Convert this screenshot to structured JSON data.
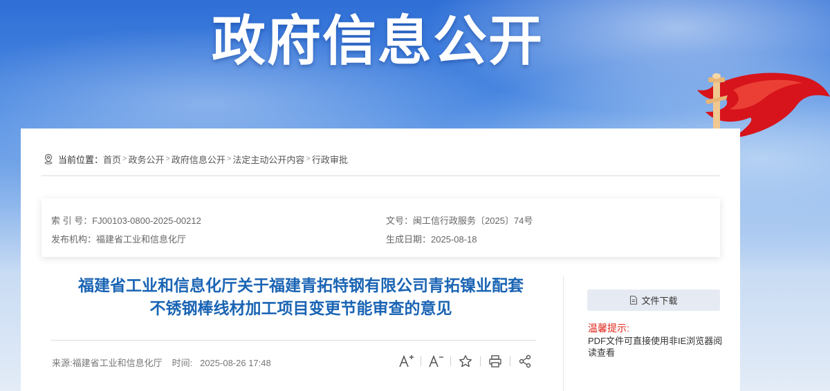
{
  "banner": {
    "title": "政府信息公开"
  },
  "breadcrumb": {
    "label": "当前位置：",
    "items": [
      "首页",
      "政务公开",
      "政府信息公开",
      "法定主动公开内容",
      "行政审批"
    ],
    "separator": ">"
  },
  "meta": {
    "index_label": "索 引 号：",
    "index_value": "FJ00103-0800-2025-00212",
    "doc_no_label": "文号：",
    "doc_no_value": "闽工信行政服务〔2025〕74号",
    "publisher_label": "发布机构：",
    "publisher_value": "福建省工业和信息化厅",
    "date_label": "生成日期：",
    "date_value": "2025-08-18"
  },
  "article": {
    "title_line1": "福建省工业和信息化厅关于福建青拓特钢有限公司青拓镍业配套",
    "title_line2": "不锈钢棒线材加工项目变更节能审查的意见",
    "source": "来源:福建省工业和信息化厅",
    "time_label": "时间:",
    "time_value": "2025-08-26 17:48"
  },
  "tools": [
    "font-larger-icon",
    "font-smaller-icon",
    "favorite-star-icon",
    "print-icon",
    "share-icon"
  ],
  "sidebar": {
    "download_label": "文件下载",
    "tip_title": "温馨提示:",
    "tip_text": "PDF文件可直接使用非IE浏览器阅读查看"
  },
  "colors": {
    "title_blue": "#1a64b4",
    "tip_red": "#e1251b",
    "banner_blue": "#2f6fd6"
  }
}
